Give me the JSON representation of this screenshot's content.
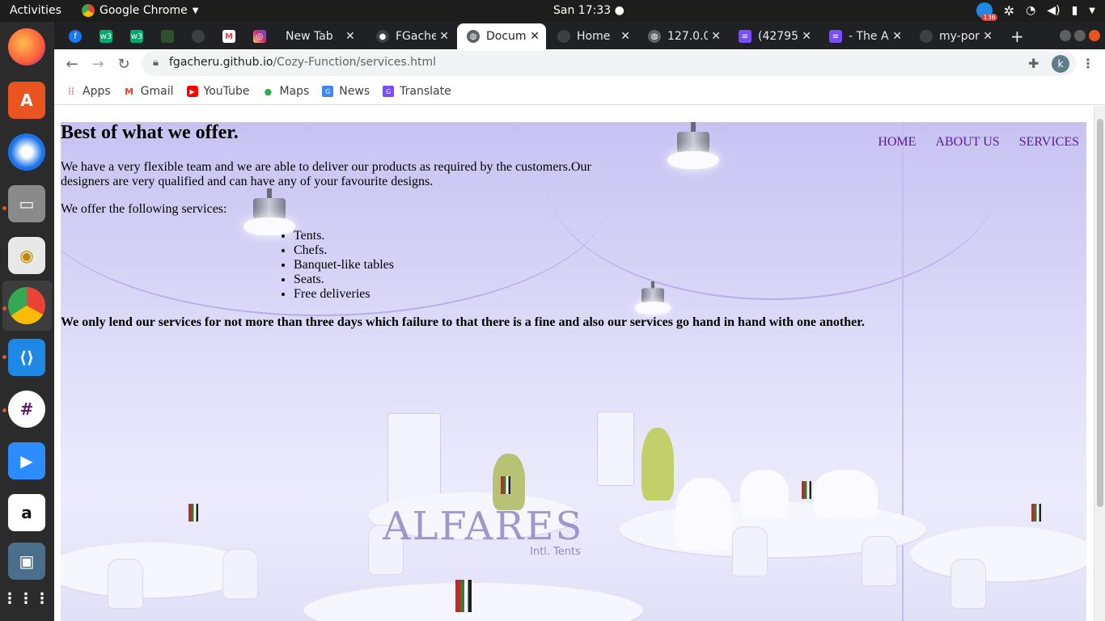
{
  "system": {
    "activities": "Activities",
    "app_name": "Google Chrome",
    "clock": "San 17:33",
    "notification_count": "136"
  },
  "tabs": [
    {
      "title": "",
      "icon": "facebook-icon",
      "color": "#1877f2"
    },
    {
      "title": "",
      "icon": "w3-icon",
      "color": "#04aa6d"
    },
    {
      "title": "",
      "icon": "w3-icon",
      "color": "#04aa6d"
    },
    {
      "title": "",
      "icon": "generic-icon",
      "color": "#3c4043"
    },
    {
      "title": "",
      "icon": "generic-icon",
      "color": "#3c4043"
    },
    {
      "title": "",
      "icon": "gmail-icon",
      "color": "#ea4335"
    },
    {
      "title": "",
      "icon": "instagram-icon",
      "color": "#c13584"
    },
    {
      "title": "New Tab",
      "icon": "none"
    },
    {
      "title": "FGache",
      "icon": "github-icon"
    },
    {
      "title": "Docum",
      "icon": "globe-icon",
      "active": true
    },
    {
      "title": "Home",
      "icon": "generic-icon"
    },
    {
      "title": "127.0.0",
      "icon": "globe-icon"
    },
    {
      "title": "(42795",
      "icon": "doc-icon",
      "color": "#7c4dff"
    },
    {
      "title": "- The A",
      "icon": "doc-icon",
      "color": "#7c4dff"
    },
    {
      "title": "my-por",
      "icon": "generic-icon"
    }
  ],
  "address": {
    "domain": "fgacheru.github.io",
    "path": "/Cozy-Function/services.html"
  },
  "profile_initial": "k",
  "bookmarks": [
    {
      "label": "Apps",
      "icon": "apps-grid-icon"
    },
    {
      "label": "Gmail",
      "icon": "gmail-icon"
    },
    {
      "label": "YouTube",
      "icon": "youtube-icon"
    },
    {
      "label": "Maps",
      "icon": "maps-icon"
    },
    {
      "label": "News",
      "icon": "news-icon"
    },
    {
      "label": "Translate",
      "icon": "translate-icon"
    }
  ],
  "page": {
    "heading": "Best of what we offer.",
    "intro": "We have a very flexible team and we are able to deliver our products as required by the customers.Our designers are very qualified and can have any of your favourite designs.",
    "offer_lead": "We offer the following services:",
    "services": [
      "Tents.",
      "Chefs.",
      "Banquet-like tables",
      "Seats.",
      "Free deliveries"
    ],
    "note": "We only lend our services for not more than three days which failure to that there is a fine and also our services go hand in hand with one another.",
    "nav": [
      "HOME",
      "ABOUT US",
      "SERVICES"
    ],
    "image_logo": "ALFARES",
    "image_logo_sub": "Intl. Tents"
  }
}
